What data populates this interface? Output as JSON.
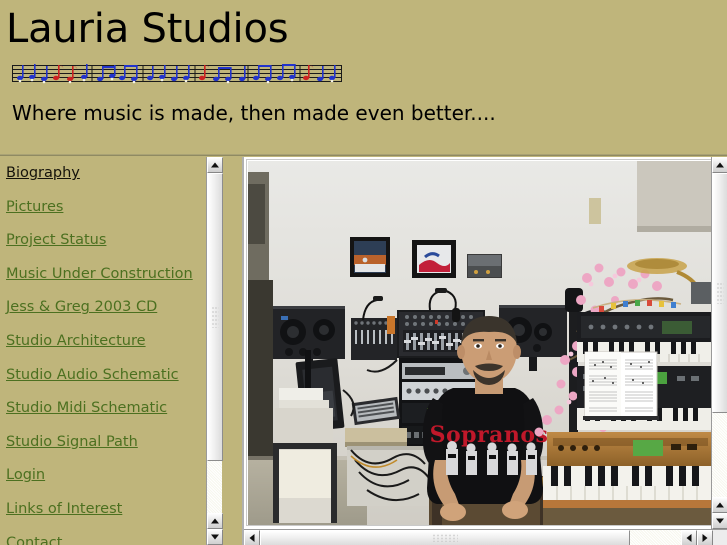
{
  "header": {
    "site_title": "Lauria Studios",
    "tagline": "Where music is made, then made even better....",
    "banner_alt": "musical-staff-banner"
  },
  "colors": {
    "page_background": "#bfb57b",
    "link": "#4c7020",
    "visited_link": "#15130b",
    "text": "#000000",
    "frame_background": "#ffffff",
    "scrollbar_face": "#ededed",
    "note_blue": "#2233cc",
    "note_red": "#cc2222"
  },
  "sidebar": {
    "items": [
      {
        "label": "Biography",
        "state": "visited"
      },
      {
        "label": "Pictures",
        "state": "link"
      },
      {
        "label": "Project Status",
        "state": "link"
      },
      {
        "label": "Music Under Construction",
        "state": "link"
      },
      {
        "label": "Jess & Greg 2003 CD",
        "state": "link"
      },
      {
        "label": "Studio Architecture",
        "state": "link"
      },
      {
        "label": "Studio Audio Schematic",
        "state": "link"
      },
      {
        "label": "Studio Midi Schematic",
        "state": "link"
      },
      {
        "label": "Studio Signal Path",
        "state": "link"
      },
      {
        "label": "Login",
        "state": "link"
      },
      {
        "label": "Links of Interest",
        "state": "link"
      },
      {
        "label": "Contact",
        "state": "link"
      }
    ],
    "scrollbar": {
      "up_arrow": "scroll-up-arrow",
      "down_arrow": "scroll-down-arrow"
    }
  },
  "main": {
    "image_alt": "recording-studio-photograph",
    "image_description": "Man seated in a home recording studio wearing a black Sopranos t-shirt, surrounded by studio monitors, mixing consoles, rack gear, synthesizers and a music stand",
    "tshirt_text": "Sopranos",
    "scrollbar": {
      "up_arrow": "scroll-up-arrow",
      "down_arrow": "scroll-down-arrow",
      "left_arrow": "scroll-left-arrow",
      "right_arrow": "scroll-right-arrow"
    }
  }
}
